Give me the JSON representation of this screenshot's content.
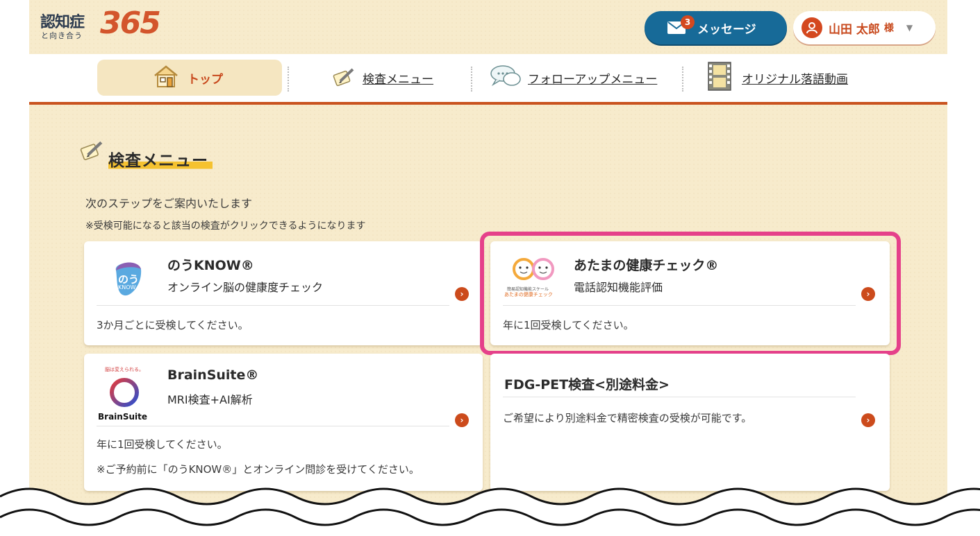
{
  "header": {
    "logo": {
      "kanji": "認知症",
      "sub": "と向き合う",
      "number": "365"
    },
    "message_button": {
      "label": "メッセージ",
      "badge": "3",
      "icon": "envelope-icon"
    },
    "user_button": {
      "name": "山田 太郎",
      "suffix": "様",
      "icon": "person-icon"
    }
  },
  "nav": {
    "items": [
      {
        "label": "トップ",
        "icon": "house-icon",
        "active": true
      },
      {
        "label": "検査メニュー",
        "icon": "pencil-notebook-icon",
        "active": false
      },
      {
        "label": "フォローアップメニュー",
        "icon": "speech-bubble-icon",
        "active": false
      },
      {
        "label": "オリジナル落語動画",
        "icon": "film-icon",
        "active": false
      }
    ]
  },
  "section": {
    "title": "検査メニュー",
    "intro": "次のステップをご案内いたします",
    "notice": "※受検可能になると該当の検査がクリックできるようになります"
  },
  "cards": [
    {
      "name": "のうKNOW®",
      "desc": "オンライン脳の健康度チェック",
      "notes": [
        "3か月ごとに受検してください。"
      ],
      "logo": "noukNOW-logo",
      "logo_text": [
        "のう",
        "KNOW"
      ]
    },
    {
      "name": "あたまの健康チェック®",
      "desc": "電話認知機能評価",
      "notes": [
        "年に1回受検してください。"
      ],
      "logo": "atama-check-logo",
      "logo_text": [
        "簡易認知機能スケール",
        "あたまの健康チェック"
      ],
      "highlighted": true
    },
    {
      "name": "BrainSuite®",
      "desc": "MRI検査+AI解析",
      "notes": [
        "年に1回受検してください。",
        "※ご予約前に「のうKNOW®」とオンライン問診を受けてください。"
      ],
      "logo": "brainsuite-logo",
      "logo_text": [
        "脳は変えられる。",
        "BrainSuite"
      ]
    },
    {
      "name": "FDG-PET検査<別途料金>",
      "desc": "",
      "notes": [
        "ご希望により別途料金で精密検査の受検が可能です。"
      ],
      "logo": ""
    }
  ],
  "colors": {
    "accent": "#c9531f",
    "message_blue": "#176a98",
    "highlight": "#e5418a",
    "background": "#f7ebcc"
  }
}
